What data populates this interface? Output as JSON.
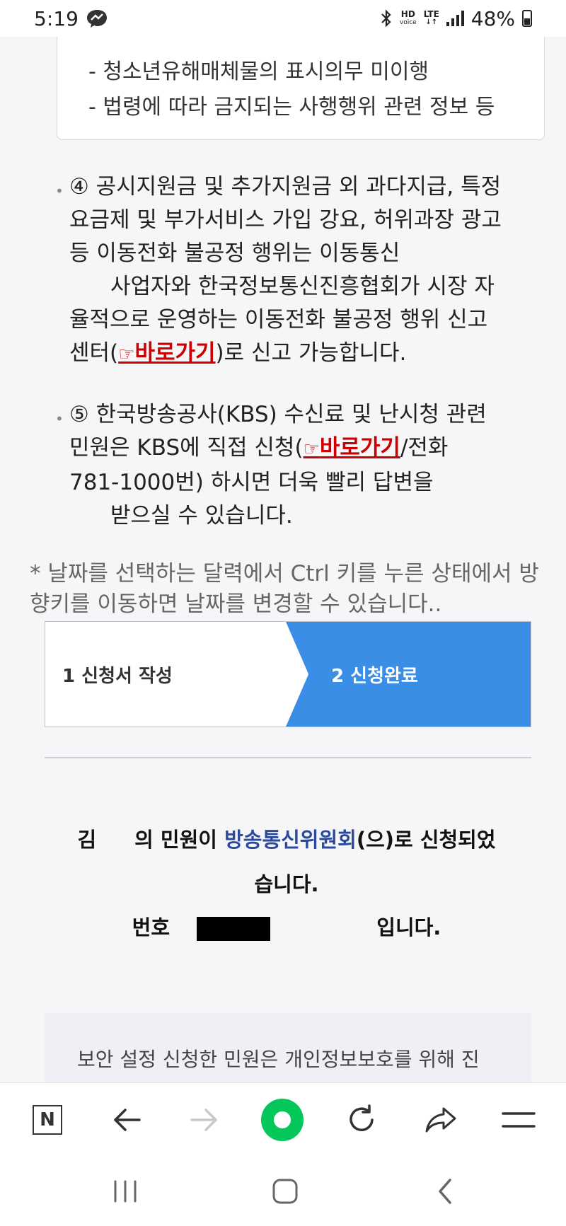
{
  "status": {
    "time": "5:19",
    "hd_label": "HD",
    "voice_label": "voice",
    "lte_label": "LTE",
    "battery": "48%"
  },
  "notice_lines": [
    "- 청소년유해매체물의 표시의무 미이행",
    "- 법령에 따라 금지되는 사행행위 관련 정보 등"
  ],
  "item4": {
    "line1": "④ 공시지원금 및 추가지원금 외 과다지급, 특정",
    "line2": "요금제 및 부가서비스 가입 강요, 허위과장 광고",
    "line3": "등 이동전화 불공정 행위는 이동통신",
    "line4": "사업자와 한국정보통신진흥협회가 시장 자",
    "line5": "율적으로 운영하는 이동전화 불공정 행위 신고",
    "line6_pre": "센터(",
    "link": "바로가기",
    "line6_post": ")로 신고 가능합니다."
  },
  "item5": {
    "line1": "⑤ 한국방송공사(KBS) 수신료 및 난시청 관련",
    "line2_pre": "민원은 KBS에 직접 신청(",
    "link": "바로가기",
    "line2_post": "/전화",
    "line3": "781-1000번) 하시면 더욱 빨리 답변을",
    "line4": "받으실 수 있습니다."
  },
  "hint": "* 날짜를 선택하는 달력에서 Ctrl 키를 누른 상태에서 방향키를 이동하면 날짜를 변경할 수 있습니다..",
  "steps": {
    "step1": "1 신청서 작성",
    "step2": "2 신청완료",
    "active_color": "#3a8ee6"
  },
  "result": {
    "name_fragment": "김",
    "mid": "의 민원이 ",
    "agency": "방송통신위원회",
    "suffix": "(으)로 신청되었",
    "line2": "습니다.",
    "line3_pre": "번호",
    "line3_post": "입니다."
  },
  "security_notice": "보안 설정 신청한 민원은 개인정보보호를 위해 진",
  "toolbar": {
    "naver_label": "N",
    "items": [
      "naver-home",
      "back",
      "forward",
      "green-dot",
      "refresh",
      "share",
      "menu"
    ]
  },
  "colors": {
    "accent_green": "#03c75a",
    "link_red": "#cc0000",
    "agency_blue": "#2b4a9b"
  }
}
